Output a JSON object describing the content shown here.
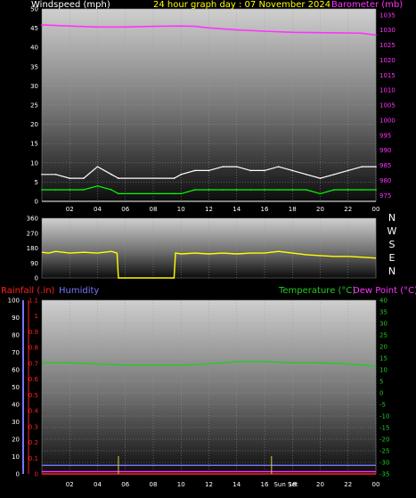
{
  "header": {
    "windspeed_label": "Windspeed (mph)",
    "title": "24 hour graph day : 07 November 2024",
    "barometer_label": "Barometer (mb)",
    "rainfall_label": "Rainfall (.in)",
    "humidity_label": "Humidity",
    "temperature_label": "Temperature (°C)",
    "dewpoint_label": "Dew Point (°C)",
    "sunset_label": "Sun Set"
  },
  "colors": {
    "windspeed": "#ffffff",
    "title": "#ffff00",
    "barometer": "#ff33ff",
    "rainfall": "#ff2020",
    "humidity": "#7777ff",
    "temperature": "#22cc22",
    "dewpoint": "#ff33ff",
    "direction": "#ffff00",
    "gust": "#ffffff",
    "avg_wind": "#00ff00"
  },
  "x_ticks": [
    "02",
    "04",
    "06",
    "08",
    "10",
    "12",
    "14",
    "16",
    "18",
    "20",
    "22",
    "00"
  ],
  "direction_letters": [
    "N",
    "W",
    "S",
    "E",
    "N"
  ],
  "chart_data": [
    {
      "id": "wind-pressure",
      "type": "line",
      "title": "24 hour graph day : 07 November 2024",
      "ylabel": "Windspeed (mph)",
      "y2label": "Barometer (mb)",
      "ylim": [
        0,
        50
      ],
      "y_ticks": [
        0,
        5,
        10,
        15,
        20,
        25,
        30,
        35,
        40,
        45,
        50
      ],
      "y2lim": [
        973,
        1037
      ],
      "y2_ticks": [
        975,
        980,
        985,
        990,
        995,
        1000,
        1005,
        1010,
        1015,
        1020,
        1025,
        1030,
        1035
      ],
      "x_hours": [
        0,
        1,
        2,
        3,
        4,
        5,
        5.5,
        9.5,
        10,
        11,
        12,
        13,
        14,
        15,
        16,
        17,
        18,
        19,
        20,
        21,
        22,
        23,
        24
      ],
      "series": [
        {
          "name": "Barometer (mb)",
          "axis": "right",
          "x": [
            0,
            2,
            4,
            6,
            8,
            10,
            11,
            12,
            14,
            16,
            18,
            20,
            22,
            23,
            24
          ],
          "values": [
            1031.7,
            1031.3,
            1031.0,
            1031.0,
            1031.2,
            1031.3,
            1031.2,
            1030.7,
            1030.0,
            1029.6,
            1029.2,
            1029.1,
            1029.0,
            1028.9,
            1028.3
          ]
        },
        {
          "name": "Gust (mph)",
          "axis": "left",
          "x": [
            0,
            1,
            2,
            3,
            4,
            5,
            5.5,
            9.5,
            10,
            11,
            12,
            13,
            14,
            15,
            16,
            17,
            18,
            19,
            20,
            21,
            22,
            23,
            24
          ],
          "values": [
            7,
            7,
            6,
            6,
            9,
            7,
            6,
            6,
            7,
            8,
            8,
            9,
            9,
            8,
            8,
            9,
            8,
            7,
            6,
            7,
            8,
            9,
            9
          ]
        },
        {
          "name": "Average (mph)",
          "axis": "left",
          "x": [
            0,
            1,
            2,
            3,
            4,
            5,
            5.5,
            9.5,
            10,
            11,
            12,
            13,
            14,
            15,
            16,
            17,
            18,
            19,
            20,
            21,
            22,
            23,
            24
          ],
          "values": [
            3,
            3,
            3,
            3,
            4,
            3,
            2,
            2,
            2,
            3,
            3,
            3,
            3,
            3,
            3,
            3,
            3,
            3,
            2,
            3,
            3,
            3,
            3
          ]
        }
      ]
    },
    {
      "id": "wind-direction",
      "type": "line",
      "ylim": [
        0,
        360
      ],
      "y_ticks": [
        0,
        90,
        180,
        270,
        360
      ],
      "series": [
        {
          "name": "Direction",
          "x": [
            0,
            0.5,
            1,
            2,
            3,
            4,
            5,
            5.4,
            5.5,
            9.5,
            9.6,
            10,
            11,
            12,
            13,
            14,
            15,
            16,
            17,
            18,
            19,
            20,
            21,
            22,
            23,
            24
          ],
          "values": [
            155,
            150,
            160,
            150,
            155,
            150,
            160,
            150,
            0,
            0,
            150,
            145,
            150,
            145,
            150,
            145,
            150,
            150,
            160,
            150,
            140,
            135,
            130,
            130,
            125,
            120
          ]
        }
      ]
    },
    {
      "id": "temp-hum-rain",
      "type": "line",
      "y_left_humidity": {
        "label": "Humidity",
        "ylim": [
          0,
          100
        ],
        "ticks": [
          0,
          10,
          20,
          30,
          40,
          50,
          60,
          70,
          80,
          90,
          100
        ]
      },
      "y_left_rain": {
        "label": "Rainfall (.in)",
        "ylim": [
          0,
          1.1
        ],
        "ticks": [
          "0",
          "0.1",
          "0.2",
          "0.3",
          "0.4",
          "0.5",
          "0.6",
          "0.7",
          "0.8",
          "0.9",
          "1",
          "1.1"
        ]
      },
      "y_right": {
        "label": "Temperature (°C) / Dew Point (°C)",
        "ylim": [
          -35,
          40
        ],
        "ticks": [
          40,
          35,
          30,
          25,
          20,
          15,
          10,
          5,
          0,
          -5,
          -10,
          -15,
          -20,
          -25,
          -30,
          -35
        ]
      },
      "series": [
        {
          "name": "Temperature (°C)",
          "x": [
            0,
            2,
            4,
            6,
            8,
            10,
            12,
            13,
            14,
            16,
            18,
            20,
            22,
            24
          ],
          "values": [
            13,
            13,
            12.5,
            12,
            12,
            12,
            12.5,
            13,
            13.5,
            13.5,
            13,
            13,
            12.5,
            11.5
          ]
        },
        {
          "name": "Humidity",
          "x": [
            0,
            24
          ],
          "values": [
            5,
            5
          ]
        },
        {
          "name": "Dew Point (°C)",
          "x": [
            0,
            24
          ],
          "values": [
            -34,
            -34
          ]
        },
        {
          "name": "Rainfall (.in)",
          "x": [
            0,
            24
          ],
          "values": [
            0,
            0
          ]
        }
      ]
    }
  ]
}
